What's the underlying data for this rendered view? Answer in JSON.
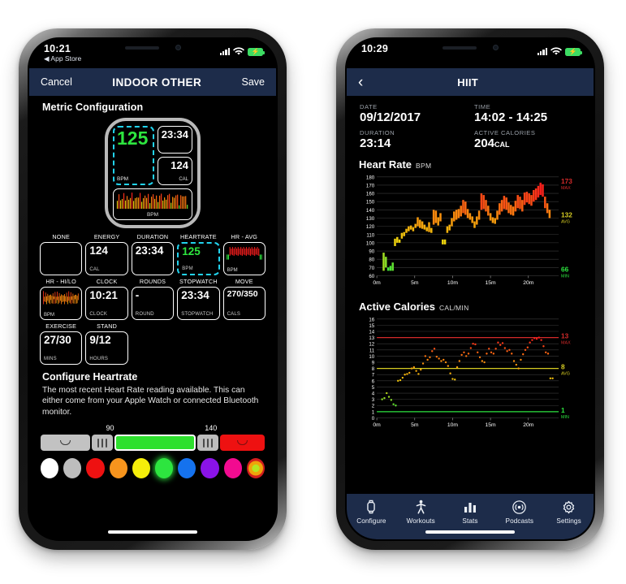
{
  "left_phone": {
    "status_bar": {
      "time": "10:21",
      "back_app": "◀ App Store",
      "battery_icon": "battery-charging-icon",
      "wifi_icon": "wifi-icon",
      "signal_icon": "cellular-signal-icon"
    },
    "navbar": {
      "cancel": "Cancel",
      "title": "INDOOR OTHER",
      "save": "Save"
    },
    "section_title": "Metric Configuration",
    "watch_preview": {
      "heartrate": {
        "value": "125",
        "unit": "BPM"
      },
      "duration": {
        "value": "23:34",
        "unit": ""
      },
      "energy": {
        "value": "124",
        "unit": "CAL"
      },
      "sparkline": {
        "unit": "BPM"
      }
    },
    "metrics": [
      {
        "label": "NONE",
        "value": "",
        "unit": "",
        "type": "empty",
        "selected": false
      },
      {
        "label": "ENERGY",
        "value": "124",
        "unit": "CAL",
        "type": "text",
        "selected": false
      },
      {
        "label": "DURATION",
        "value": "23:34",
        "unit": "",
        "type": "text",
        "selected": false
      },
      {
        "label": "HEARTRATE",
        "value": "125",
        "unit": "BPM",
        "type": "text",
        "selected": true
      },
      {
        "label": "HR - AVG",
        "value": "",
        "unit": "BPM",
        "type": "chart",
        "selected": false
      },
      {
        "label": "HR - HI/LO",
        "value": "",
        "unit": "BPM",
        "type": "chart2",
        "selected": false
      },
      {
        "label": "CLOCK",
        "value": "10:21",
        "unit": "CLOCK",
        "type": "text",
        "selected": false
      },
      {
        "label": "ROUNDS",
        "value": "-",
        "unit": "ROUND",
        "type": "text",
        "selected": false
      },
      {
        "label": "STOPWATCH",
        "value": "23:34",
        "unit": "STOPWATCH",
        "type": "text",
        "selected": false
      },
      {
        "label": "MOVE",
        "value": "270/350",
        "unit": "CALS",
        "type": "small",
        "selected": false
      },
      {
        "label": "EXERCISE",
        "value": "27/30",
        "unit": "MINS",
        "type": "text",
        "selected": false
      },
      {
        "label": "STAND",
        "value": "9/12",
        "unit": "HOURS",
        "type": "text",
        "selected": false
      }
    ],
    "config": {
      "title": "Configure Heartrate",
      "description": "The most recent Heart Rate reading available. This can either come from your Apple Watch or connected Bluetooth monitor."
    },
    "slider": {
      "low_mark": "90",
      "high_mark": "140",
      "low_color": "#c2c2c2",
      "mid_color": "#2ee02e",
      "high_color": "#ee1111"
    },
    "swatches": [
      {
        "name": "white",
        "color": "#ffffff",
        "selected": false
      },
      {
        "name": "gray",
        "color": "#bdbdbd",
        "selected": false
      },
      {
        "name": "red",
        "color": "#ee1111",
        "selected": false
      },
      {
        "name": "orange",
        "color": "#f7941d",
        "selected": false
      },
      {
        "name": "yellow",
        "color": "#f5ee0a",
        "selected": false
      },
      {
        "name": "green",
        "color": "#2de53f",
        "selected": true
      },
      {
        "name": "blue",
        "color": "#1572ee",
        "selected": false
      },
      {
        "name": "purple",
        "color": "#8a13e8",
        "selected": false
      },
      {
        "name": "magenta",
        "color": "#f20b90",
        "selected": false
      },
      {
        "name": "multi",
        "color": "multi",
        "selected": false
      }
    ]
  },
  "right_phone": {
    "status_bar": {
      "time": "10:29",
      "battery_icon": "battery-charging-icon",
      "wifi_icon": "wifi-icon",
      "signal_icon": "cellular-signal-icon"
    },
    "navbar": {
      "back_icon": "chevron-left-icon",
      "title": "HIIT"
    },
    "summary": [
      {
        "label": "DATE",
        "value": "09/12/2017",
        "unit": ""
      },
      {
        "label": "TIME",
        "value": "14:02 - 14:25",
        "unit": ""
      },
      {
        "label": "DURATION",
        "value": "23:14",
        "unit": ""
      },
      {
        "label": "ACTIVE CALORIES",
        "value": "204",
        "unit": "CAL"
      }
    ],
    "tabs": [
      {
        "label": "Configure",
        "icon": "watch-icon",
        "active": false
      },
      {
        "label": "Workouts",
        "icon": "runner-icon",
        "active": false
      },
      {
        "label": "Stats",
        "icon": "bar-chart-icon",
        "active": false
      },
      {
        "label": "Podcasts",
        "icon": "broadcast-icon",
        "active": false
      },
      {
        "label": "Settings",
        "icon": "gear-icon",
        "active": false
      }
    ]
  },
  "chart_data": [
    {
      "type": "bar",
      "title": "Heart Rate",
      "subtitle": "BPM",
      "xlabel": "",
      "ylabel": "BPM",
      "ylim": [
        60,
        180
      ],
      "yticks": [
        60,
        70,
        80,
        90,
        100,
        110,
        120,
        130,
        140,
        150,
        160,
        170,
        180
      ],
      "xticks": [
        "0m",
        "5m",
        "10m",
        "15m",
        "20m"
      ],
      "xlim": [
        0,
        24
      ],
      "grid": true,
      "annotations": [
        {
          "label": "MAX",
          "value": 173,
          "color": "#d42a2a"
        },
        {
          "label": "AVG",
          "value": 132,
          "color": "#d6cc22"
        },
        {
          "label": "MIN",
          "value": 66,
          "color": "#2de53f"
        }
      ],
      "x": [
        0.9,
        1.2,
        1.5,
        1.8,
        2.1,
        2.4,
        2.7,
        3.0,
        3.3,
        3.6,
        3.9,
        4.2,
        4.5,
        4.8,
        5.1,
        5.4,
        5.7,
        6.0,
        6.3,
        6.6,
        6.9,
        7.2,
        7.5,
        7.8,
        8.1,
        8.4,
        8.7,
        9.0,
        9.3,
        9.6,
        9.9,
        10.2,
        10.5,
        10.8,
        11.1,
        11.4,
        11.7,
        12.0,
        12.3,
        12.6,
        12.9,
        13.2,
        13.5,
        13.8,
        14.1,
        14.4,
        14.7,
        15.0,
        15.3,
        15.6,
        15.9,
        16.2,
        16.5,
        16.8,
        17.1,
        17.4,
        17.7,
        18.0,
        18.3,
        18.6,
        18.9,
        19.2,
        19.5,
        19.8,
        20.1,
        20.4,
        20.7,
        21.0,
        21.3,
        21.6,
        21.9,
        22.2,
        22.5,
        22.8
      ],
      "high": [
        88,
        83,
        70,
        72,
        76,
        105,
        107,
        104,
        112,
        113,
        117,
        120,
        121,
        119,
        123,
        131,
        128,
        126,
        122,
        119,
        125,
        118,
        140,
        139,
        131,
        136,
        104,
        104,
        120,
        122,
        130,
        138,
        140,
        141,
        145,
        152,
        150,
        141,
        136,
        132,
        126,
        132,
        139,
        160,
        158,
        152,
        145,
        136,
        131,
        130,
        139,
        148,
        152,
        157,
        155,
        149,
        146,
        144,
        151,
        158,
        156,
        152,
        161,
        162,
        160,
        158,
        164,
        166,
        169,
        173,
        171,
        156,
        148,
        140
      ],
      "low": [
        66,
        70,
        66,
        66,
        66,
        96,
        100,
        100,
        105,
        108,
        112,
        114,
        116,
        114,
        118,
        120,
        118,
        117,
        116,
        114,
        113,
        112,
        122,
        124,
        121,
        126,
        98,
        98,
        112,
        115,
        120,
        126,
        128,
        130,
        132,
        136,
        134,
        130,
        128,
        124,
        118,
        122,
        128,
        140,
        141,
        138,
        133,
        127,
        124,
        123,
        128,
        134,
        138,
        141,
        140,
        136,
        134,
        133,
        138,
        142,
        141,
        138,
        146,
        149,
        147,
        145,
        150,
        152,
        155,
        158,
        156,
        142,
        136,
        130
      ],
      "series_note": "vertical bars: each bar spans the low→high heart-rate range in that sample window; color ramps green→yellow→orange→red with value"
    },
    {
      "type": "scatter",
      "title": "Active Calories",
      "subtitle": "CAL/MIN",
      "xlabel": "",
      "ylabel": "CAL/MIN",
      "ylim": [
        0,
        16
      ],
      "yticks": [
        0,
        1,
        2,
        3,
        4,
        5,
        6,
        7,
        8,
        9,
        10,
        11,
        12,
        13,
        14,
        15,
        16
      ],
      "xticks": [
        "0m",
        "5m",
        "10m",
        "15m",
        "20m"
      ],
      "xlim": [
        0,
        24
      ],
      "grid": true,
      "annotations": [
        {
          "label": "MAX",
          "value": 13,
          "color": "#d42a2a"
        },
        {
          "label": "AVG",
          "value": 8,
          "color": "#d6cc22"
        },
        {
          "label": "MIN",
          "value": 1,
          "color": "#2de53f"
        }
      ],
      "x": [
        0.7,
        1.0,
        1.3,
        1.6,
        1.9,
        2.2,
        2.5,
        2.8,
        3.1,
        3.4,
        3.7,
        4.0,
        4.3,
        4.6,
        4.9,
        5.2,
        5.5,
        5.8,
        6.1,
        6.4,
        6.7,
        7.0,
        7.3,
        7.6,
        7.9,
        8.2,
        8.5,
        8.8,
        9.1,
        9.4,
        9.7,
        10.0,
        10.3,
        10.6,
        10.9,
        11.2,
        11.5,
        11.8,
        12.1,
        12.4,
        12.7,
        13.0,
        13.3,
        13.6,
        13.9,
        14.2,
        14.5,
        14.8,
        15.1,
        15.4,
        15.7,
        16.0,
        16.3,
        16.6,
        16.9,
        17.2,
        17.5,
        17.8,
        18.1,
        18.4,
        18.7,
        19.0,
        19.3,
        19.6,
        19.9,
        20.2,
        20.5,
        20.8,
        21.1,
        21.4,
        21.7,
        22.0,
        22.3,
        22.6,
        22.9,
        23.2
      ],
      "y": [
        3,
        3.2,
        4,
        3.4,
        2.9,
        2.2,
        2,
        6,
        6.1,
        6.5,
        7,
        7.1,
        7.3,
        8,
        8.2,
        7.6,
        7.1,
        7.8,
        8.8,
        10,
        9.4,
        9.8,
        10.8,
        11.2,
        9.9,
        9.6,
        9.2,
        9.4,
        9,
        8.4,
        7.2,
        6.3,
        6.2,
        8.2,
        9.2,
        10.2,
        10.6,
        10,
        10.4,
        11.3,
        12,
        11.9,
        10.6,
        9.8,
        9.2,
        9,
        10.4,
        11.2,
        10.6,
        10.4,
        11.2,
        12.2,
        11.8,
        12.1,
        11.3,
        10.8,
        11,
        10.4,
        9.2,
        8.6,
        8,
        9.4,
        10.3,
        11,
        11.4,
        12.2,
        12.6,
        12.9,
        12.8,
        13,
        12.6,
        11.6,
        10.6,
        10.4,
        6.4,
        6.4
      ],
      "series_note": "dot scatter, color ramps green→yellow→orange→red with value"
    }
  ]
}
